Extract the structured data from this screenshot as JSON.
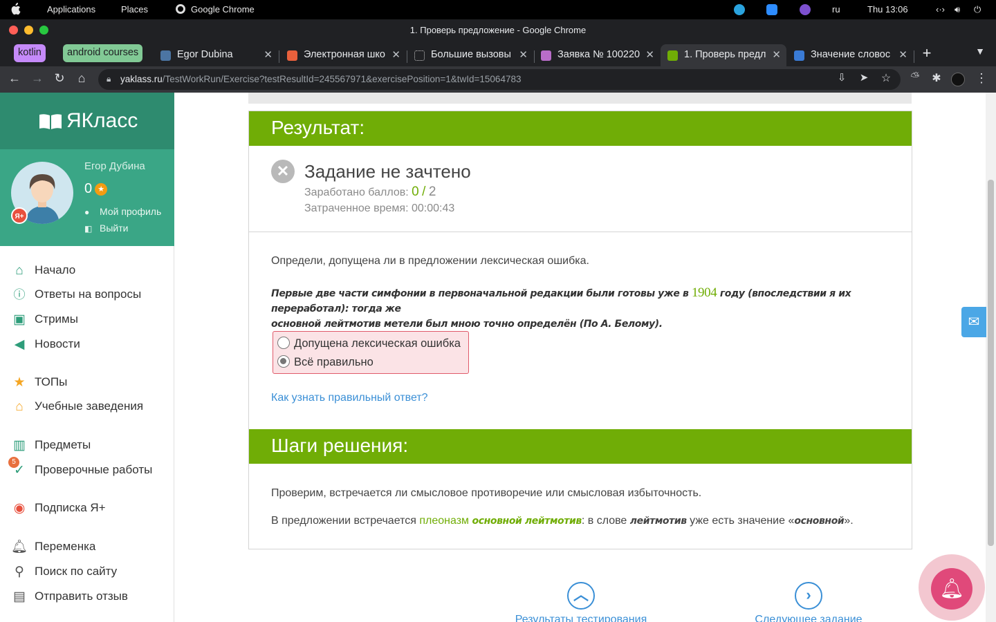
{
  "os_bar": {
    "menu": [
      "Applications",
      "Places",
      "Google Chrome"
    ],
    "language": "ru",
    "clock": "Thu 13:06"
  },
  "window": {
    "title": "1. Проверь предложение - Google Chrome"
  },
  "tab_groups": [
    {
      "label": "kotlin",
      "color": "#c58af9"
    },
    {
      "label": "android courses",
      "color": "#81c995"
    }
  ],
  "tabs": [
    {
      "label": "Egor Dubina",
      "icon": "vk-icon"
    },
    {
      "label": "Электронная шко",
      "icon": "school-icon"
    },
    {
      "label": "Большие вызовы",
      "icon": "sparkle-icon"
    },
    {
      "label": "Заявка № 100220",
      "icon": "form-icon"
    },
    {
      "label": "1. Проверь предл",
      "icon": "yaklass-icon",
      "active": true
    },
    {
      "label": "Значение словос",
      "icon": "book-icon"
    }
  ],
  "address_bar": {
    "domain": "yaklass.ru",
    "path": "/TestWorkRun/Exercise?testResultId=245567971&exercisePosition=1&twId=15064783"
  },
  "sidebar": {
    "brand": "ЯКласс",
    "user": {
      "name": "Егор Дубина",
      "points": "0",
      "badge": "Я+",
      "profile_link": "Мой профиль",
      "logout_link": "Выйти"
    },
    "nav": [
      {
        "label": "Начало",
        "icon": "home-icon"
      },
      {
        "label": "Ответы на вопросы",
        "icon": "question-icon"
      },
      {
        "label": "Стримы",
        "icon": "play-icon"
      },
      {
        "label": "Новости",
        "icon": "megaphone-icon"
      },
      {
        "label": "ТОПы",
        "icon": "star-icon"
      },
      {
        "label": "Учебные заведения",
        "icon": "institution-icon"
      },
      {
        "label": "Предметы",
        "icon": "books-icon"
      },
      {
        "label": "Проверочные работы",
        "icon": "check-circle-icon",
        "badge": "5"
      },
      {
        "label": "Подписка Я+",
        "icon": "ya-plus-icon"
      },
      {
        "label": "Переменка",
        "icon": "bell-icon"
      },
      {
        "label": "Поиск по сайту",
        "icon": "search-icon"
      },
      {
        "label": "Отправить отзыв",
        "icon": "chat-icon"
      }
    ]
  },
  "result": {
    "heading": "Результат:",
    "status": "Задание не зачтено",
    "score_label": "Заработано баллов:",
    "score": "0",
    "score_sep": "/",
    "score_max": "2",
    "time_label": "Затраченное время:",
    "time": "00:00:43"
  },
  "task": {
    "question": "Определи, допущена ли в предложении лексическая ошибка.",
    "sentence_part1": "Первые две части симфонии в первоначальной редакции были готовы уже в",
    "sentence_year": "1904",
    "sentence_part2": "году (впоследствии я их переработал): тогда же",
    "sentence_line2": "основной лейтмотив метели был мною точно определён (По А. Белому).",
    "options": [
      {
        "label": "Допущена лексическая ошибка",
        "checked": false
      },
      {
        "label": "Всё правильно",
        "checked": true
      }
    ],
    "how_link": "Как узнать правильный ответ?"
  },
  "steps": {
    "heading": "Шаги решения:",
    "line1": "Проверим, встречается ли смысловое противоречие или смысловая избыточность.",
    "line2_a": "В предложении встречается",
    "line2_kw": "плеоназм",
    "line2_phrase": "основной лейтмотив",
    "line2_b": ": в слове",
    "line2_word": "лейтмотив",
    "line2_c": "уже есть значение «",
    "line2_meaning": "основной",
    "line2_d": "»."
  },
  "bottom_nav": {
    "results": "Результаты тестирования",
    "next": "Следующее задание"
  },
  "colors": {
    "green": "#70ad06",
    "sidebar_brand": "#2e8b6f",
    "sidebar_user": "#3aa686",
    "link": "#3a8fd6",
    "error_bg": "#fbe3e6"
  }
}
